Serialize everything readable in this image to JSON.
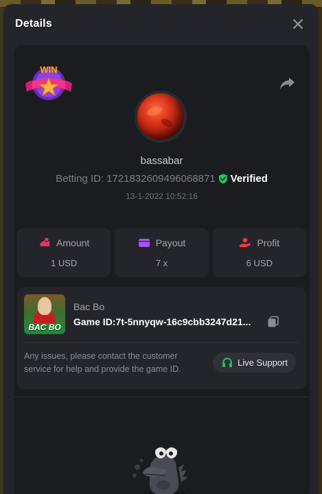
{
  "modal": {
    "title": "Details"
  },
  "player": {
    "username": "bassabar",
    "betting_id_label": "Betting ID:",
    "betting_id": "1721832609496068871",
    "verified_label": "Verified",
    "timestamp": "13-1-2022 10:52:16",
    "badge_text": "WIN"
  },
  "stats": [
    {
      "label": "Amount",
      "value": "1 USD",
      "icon": "coins-icon",
      "color": "#e8326b"
    },
    {
      "label": "Payout",
      "value": "7 x",
      "icon": "wallet-icon",
      "color": "#a855f7"
    },
    {
      "label": "Profit",
      "value": "6 USD",
      "icon": "hand-coin-icon",
      "color": "#ef3e3e"
    }
  ],
  "game": {
    "name": "Bac Bo",
    "thumb_text": "BAC BO",
    "game_id_label": "Game ID:",
    "game_id": "7t-5nnyqw-16c9cbb3247d21...",
    "help_text": "Any issues, please contact the customer service for help and provide the game ID.",
    "support_label": "Live Support"
  },
  "colors": {
    "background": "#17181b",
    "modal": "#24252a",
    "panel": "#1b1c20",
    "verified": "#22c55e",
    "support_icon": "#22c55e"
  }
}
